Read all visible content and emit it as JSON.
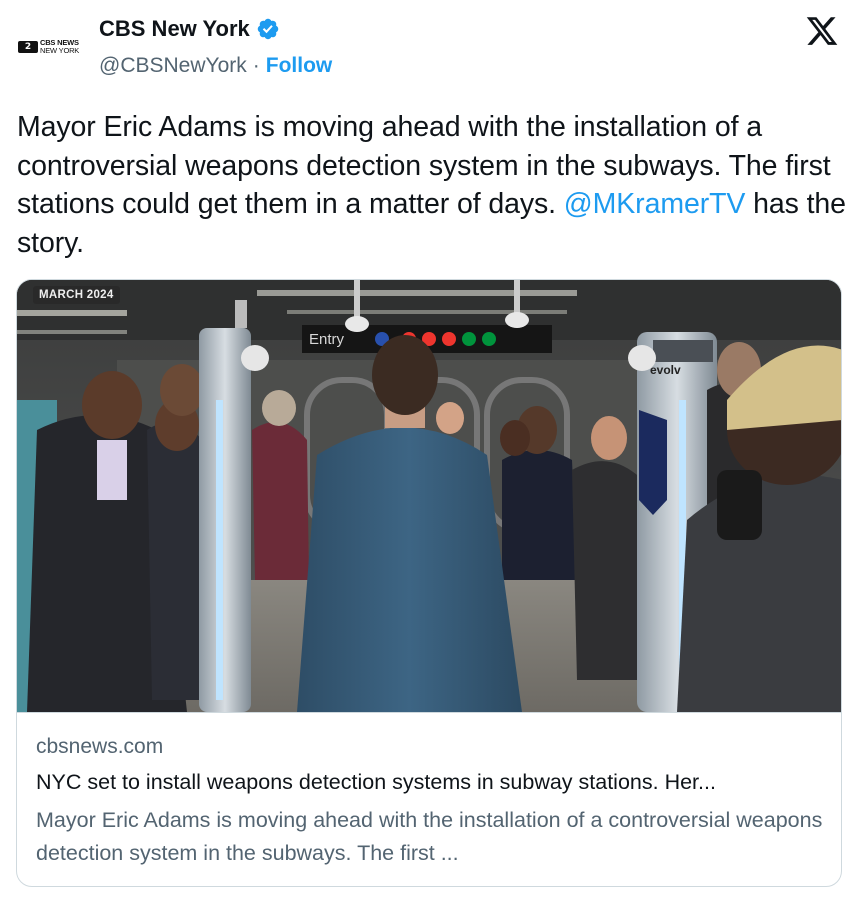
{
  "account": {
    "display_name": "CBS New York",
    "handle": "@CBSNewYork",
    "separator": "·",
    "follow_label": "Follow",
    "avatar_badge": "2",
    "avatar_line1": "CBS NEWS",
    "avatar_line2": "NEW YORK"
  },
  "tweet": {
    "text_before_mention": "Mayor Eric Adams is moving ahead with the installation of a controversial weapons detection system in the subways. The first stations could get them in a matter of days. ",
    "mention": "@MKramerTV",
    "text_after_mention": " has the story."
  },
  "media": {
    "date_tag": "MARCH 2024",
    "sign_text": "Entry",
    "scanner_brand": "evolv",
    "subway_lines": [
      "C",
      "2",
      "3",
      "4",
      "5"
    ]
  },
  "link_card": {
    "domain": "cbsnews.com",
    "title": "NYC set to install weapons detection systems in subway stations. Her...",
    "description": "Mayor Eric Adams is moving ahead with the installation of a controversial weapons detection system in the subways. The first ..."
  },
  "colors": {
    "accent": "#1d9bf0",
    "text_primary": "#0f1419",
    "text_secondary": "#536471",
    "border": "#cfd9de"
  },
  "icons": {
    "verified": "verified-badge-icon",
    "platform": "x-logo-icon"
  }
}
